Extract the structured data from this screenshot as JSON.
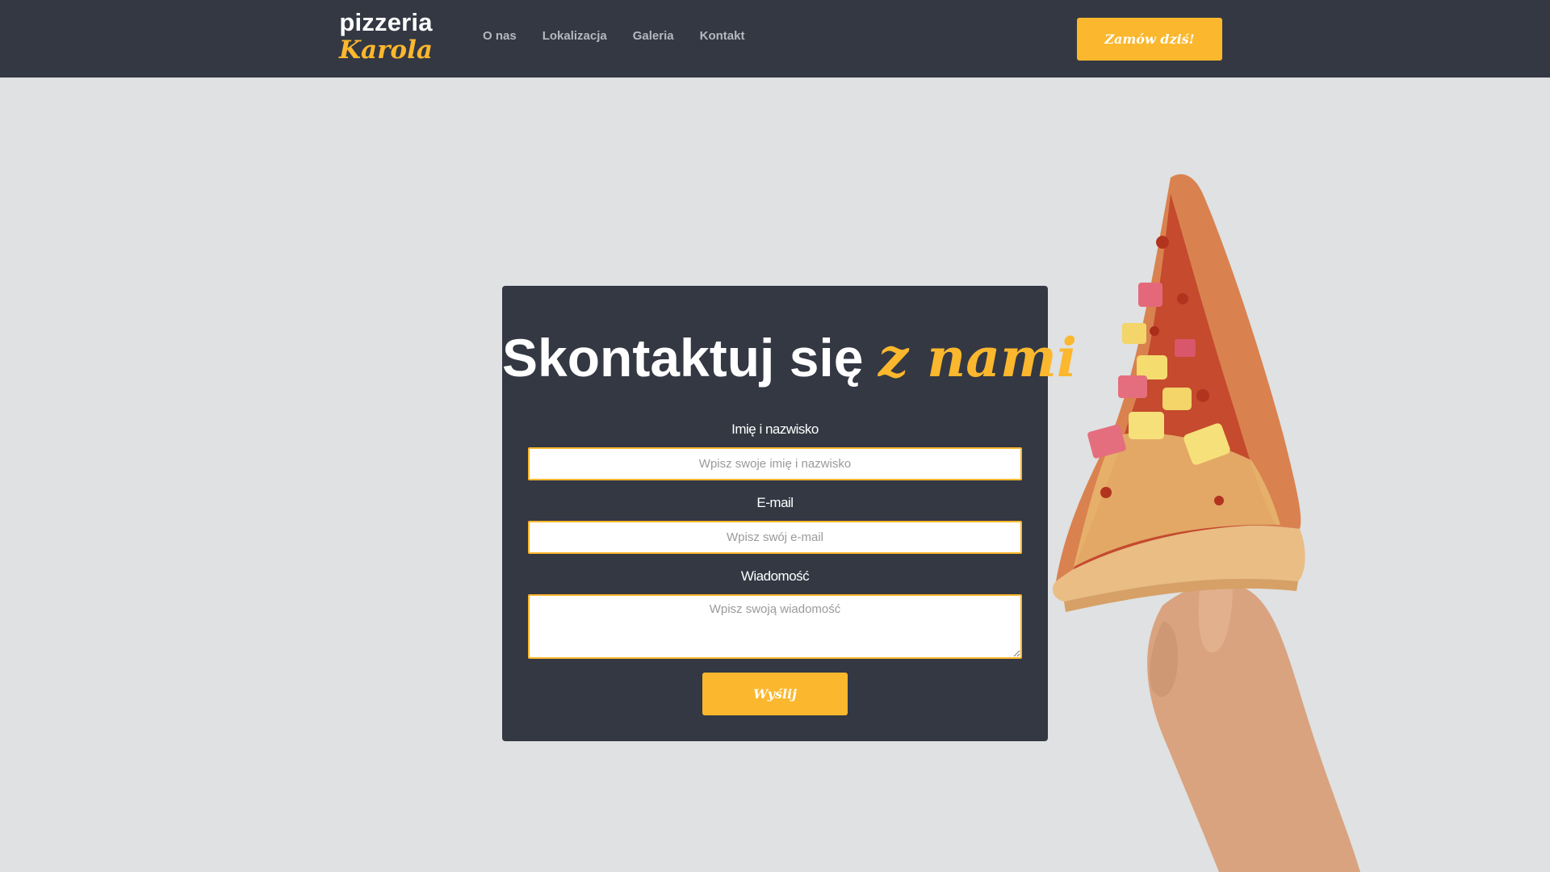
{
  "header": {
    "logo_top": "pizzeria",
    "logo_bottom": "Karola",
    "nav": [
      "O nas",
      "Lokalizacja",
      "Galeria",
      "Kontakt"
    ],
    "order_button": "Zamów dziś!"
  },
  "contact": {
    "title_main": "Skontaktuj się",
    "title_accent": "z nami",
    "name_label": "Imię i nazwisko",
    "name_placeholder": "Wpisz swoje imię i nazwisko",
    "email_label": "E-mail",
    "email_placeholder": "Wpisz swój e-mail",
    "message_label": "Wiadomość",
    "message_placeholder": "Wpisz swoją wiadomość",
    "send_button": "Wyślij"
  },
  "colors": {
    "background": "#dfe1e2",
    "dark": "#333843",
    "accent": "#fbb72d"
  }
}
